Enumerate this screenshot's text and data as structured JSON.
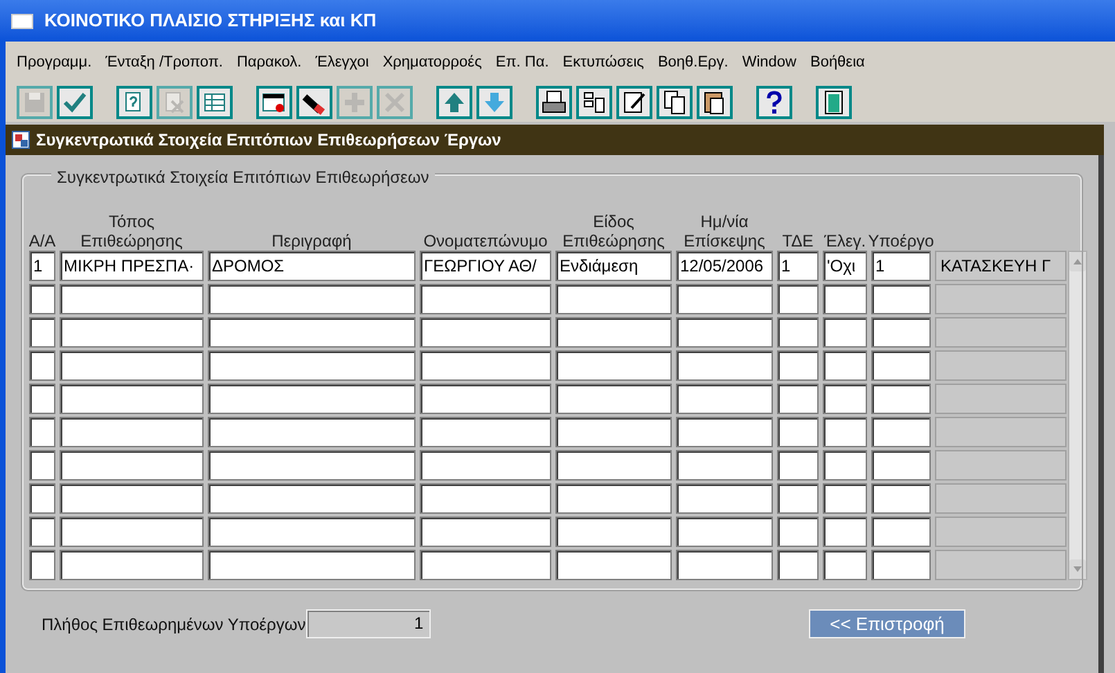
{
  "window": {
    "title": "ΚΟΙΝΟΤΙΚΟ ΠΛΑΙΣΙΟ ΣΤΗΡΙΞΗΣ και ΚΠ"
  },
  "menu": [
    "Προγραμμ.",
    "Ένταξη /Τροποπ.",
    "Παρακολ.",
    "Έλεγχοι",
    "Χρηματορροές",
    "Επ. Πα.",
    "Εκτυπώσεις",
    "Βοηθ.Εργ.",
    "Window",
    "Βοήθεια"
  ],
  "toolbar": [
    {
      "kind": "save",
      "disabled": true
    },
    {
      "kind": "check",
      "disabled": false
    },
    {
      "kind": "query",
      "disabled": false
    },
    {
      "kind": "clear",
      "disabled": true
    },
    {
      "kind": "table",
      "disabled": false
    },
    {
      "kind": "window",
      "disabled": false
    },
    {
      "kind": "edit",
      "disabled": false
    },
    {
      "kind": "add",
      "disabled": true
    },
    {
      "kind": "delete",
      "disabled": true
    },
    {
      "kind": "up",
      "disabled": false
    },
    {
      "kind": "down",
      "disabled": false
    },
    {
      "kind": "print",
      "disabled": false
    },
    {
      "kind": "list",
      "disabled": false
    },
    {
      "kind": "note",
      "disabled": false
    },
    {
      "kind": "copy",
      "disabled": false
    },
    {
      "kind": "paste",
      "disabled": false
    },
    {
      "kind": "help",
      "disabled": false
    },
    {
      "kind": "exit",
      "disabled": false
    }
  ],
  "form": {
    "title": "Συγκεντρωτικά Στοιχεία Επιτόπιων Επιθεωρήσεων Έργων",
    "group_title": "Συγκεντρωτικά Στοιχεία Επιτόπιων Επιθεωρήσεων",
    "columns": [
      "Α/Α",
      "Τόπος Επιθεώρησης",
      "Περιγραφή",
      "Ονοματεπώνυμο",
      "Είδος Επιθεώρησης",
      "Ημ/νία Επίσκεψης",
      "ΤΔΕ",
      "Έλεγ.",
      "Υποέργο"
    ],
    "rows": [
      {
        "cells": [
          "1",
          "ΜΙΚΡΗ ΠΡΕΣΠΑ·",
          "ΔΡΟΜΟΣ",
          "ΓΕΩΡΓΙΟΥ ΑΘ/",
          "Ενδιάμεση",
          "12/05/2006",
          "1",
          "'Οχι",
          "1"
        ],
        "description": "ΚΑΤΑΣΚΕΥΗ Γ"
      }
    ],
    "count_label": "Πλήθος Επιθεωρημένων Υποέργων",
    "count_value": "1",
    "back_button": "<< Επιστροφή"
  }
}
